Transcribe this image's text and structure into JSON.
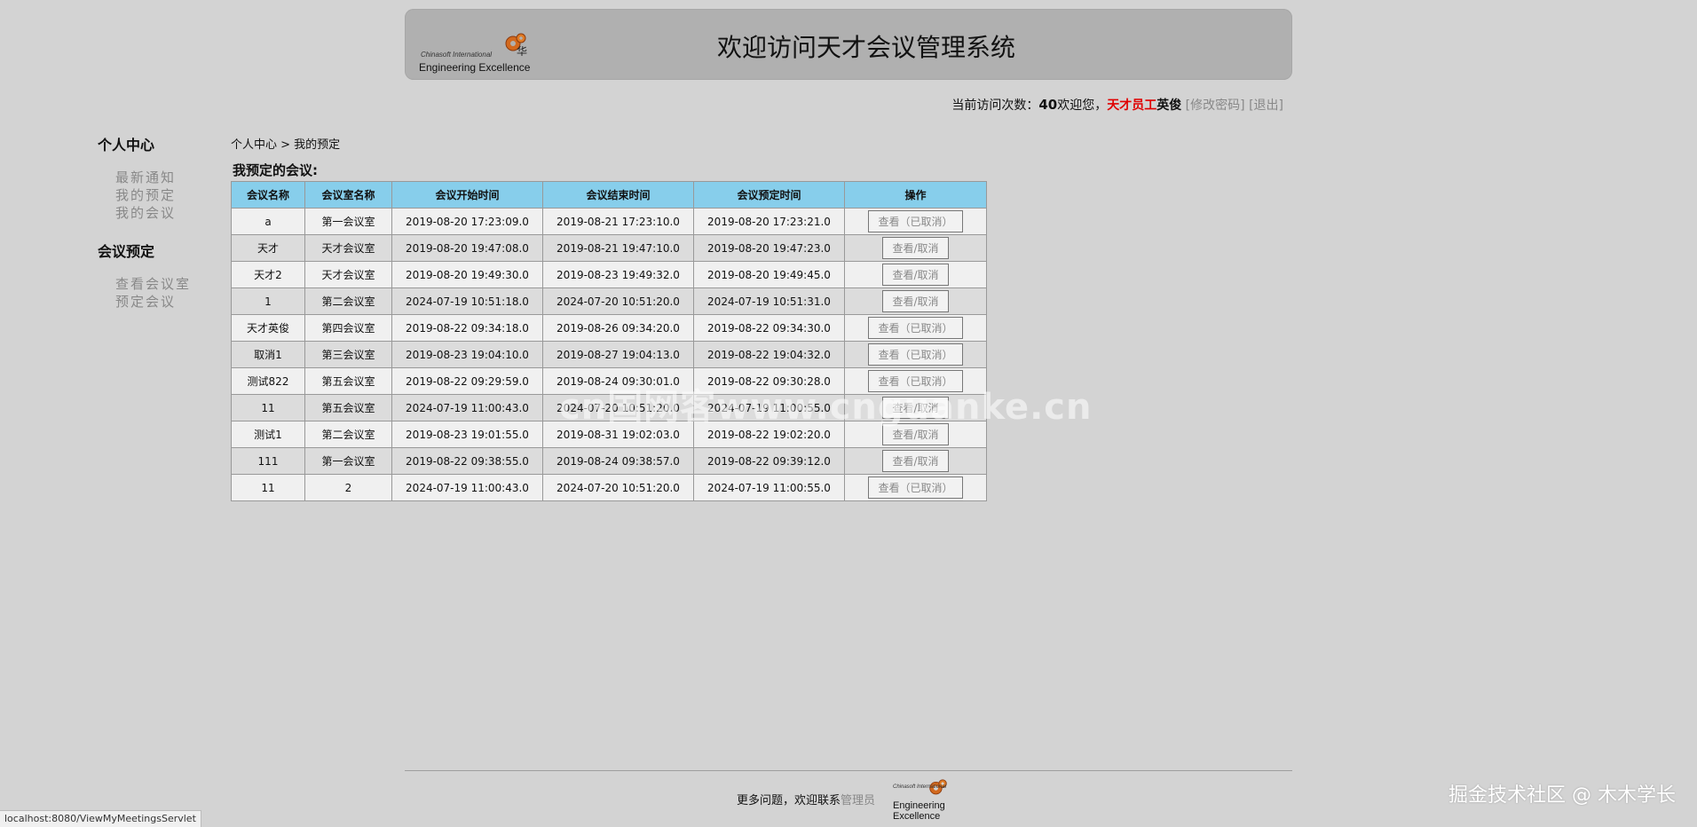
{
  "header": {
    "logo_small": "Chinasoft International",
    "logo_big": "Engineering Excellence",
    "title": "欢迎访问天才会议管理系统"
  },
  "userbar": {
    "count_label": "当前访问次数：",
    "count": "40",
    "welcome": "欢迎您，",
    "role": "天才员工",
    "name": "英俊",
    "change_password": "[修改密码]",
    "logout": "[退出]"
  },
  "sidebar": {
    "sections": [
      {
        "title": "个人中心",
        "items": [
          "最新通知",
          "我的预定",
          "我的会议"
        ]
      },
      {
        "title": "会议预定",
        "items": [
          "查看会议室",
          "预定会议"
        ]
      }
    ]
  },
  "breadcrumb": "个人中心 > 我的预定",
  "section_title": "我预定的会议:",
  "table": {
    "headers": [
      "会议名称",
      "会议室名称",
      "会议开始时间",
      "会议结束时间",
      "会议预定时间",
      "操作"
    ],
    "rows": [
      [
        "a",
        "第一会议室",
        "2019-08-20 17:23:09.0",
        "2019-08-21 17:23:10.0",
        "2019-08-20 17:23:21.0",
        "查看（已取消）"
      ],
      [
        "天才",
        "天才会议室",
        "2019-08-20 19:47:08.0",
        "2019-08-21 19:47:10.0",
        "2019-08-20 19:47:23.0",
        "查看/取消"
      ],
      [
        "天才2",
        "天才会议室",
        "2019-08-20 19:49:30.0",
        "2019-08-23 19:49:32.0",
        "2019-08-20 19:49:45.0",
        "查看/取消"
      ],
      [
        "1",
        "第二会议室",
        "2024-07-19 10:51:18.0",
        "2024-07-20 10:51:20.0",
        "2024-07-19 10:51:31.0",
        "查看/取消"
      ],
      [
        "天才英俊",
        "第四会议室",
        "2019-08-22 09:34:18.0",
        "2019-08-26 09:34:20.0",
        "2019-08-22 09:34:30.0",
        "查看（已取消）"
      ],
      [
        "取消1",
        "第三会议室",
        "2019-08-23 19:04:10.0",
        "2019-08-27 19:04:13.0",
        "2019-08-22 19:04:32.0",
        "查看（已取消）"
      ],
      [
        "测试822",
        "第五会议室",
        "2019-08-22 09:29:59.0",
        "2019-08-24 09:30:01.0",
        "2019-08-22 09:30:28.0",
        "查看（已取消）"
      ],
      [
        "11",
        "第五会议室",
        "2024-07-19 11:00:43.0",
        "2024-07-20 10:51:20.0",
        "2024-07-19 11:00:55.0",
        "查看/取消"
      ],
      [
        "测试1",
        "第二会议室",
        "2019-08-23 19:01:55.0",
        "2019-08-31 19:02:03.0",
        "2019-08-22 19:02:20.0",
        "查看/取消"
      ],
      [
        "111",
        "第一会议室",
        "2019-08-22 09:38:55.0",
        "2019-08-24 09:38:57.0",
        "2019-08-22 09:39:12.0",
        "查看/取消"
      ],
      [
        "11",
        "2",
        "2024-07-19 11:00:43.0",
        "2024-07-20 10:51:20.0",
        "2024-07-19 11:00:55.0",
        "查看（已取消）"
      ]
    ]
  },
  "watermark": "cn国网客www.cnguanke.cn",
  "footer": {
    "text": "更多问题，欢迎联系",
    "link": "管理员",
    "logo_small": "Chinasoft International",
    "logo_big": "Engineering Excellence"
  },
  "status_url": "localhost:8080/ViewMyMeetingsServlet",
  "corner_watermark": "掘金技术社区 @ 木木学长",
  "colors": {
    "page_bg": "#d3d3d3",
    "header_bg": "#b0b0b0",
    "table_header_bg": "#87ceeb",
    "role_red": "#e00000"
  }
}
